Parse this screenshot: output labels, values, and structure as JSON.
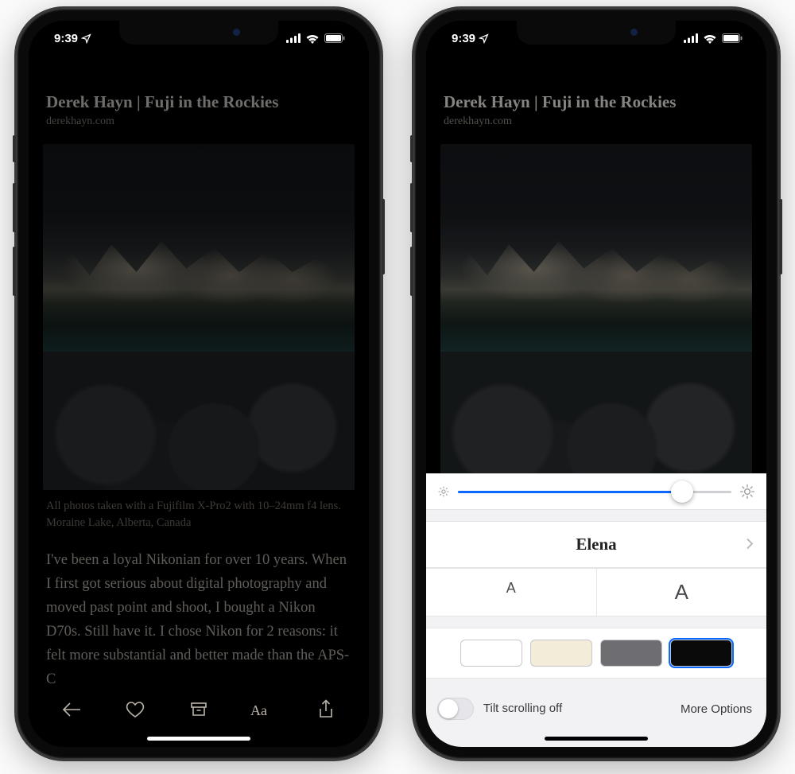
{
  "status": {
    "time": "9:39",
    "location_arrow": true
  },
  "article": {
    "title": "Derek Hayn | Fuji in the Rockies",
    "domain": "derekhayn.com",
    "caption": "All photos taken with a Fujifilm X-Pro2 with 10–24mm f4 lens. Moraine Lake, Alberta, Canada",
    "body": "I've been a loyal Nikonian for over 10 years. When I first got serious about digital photography and moved past point and shoot, I bought a Nikon D70s. Still have it. I chose Nikon for 2 reasons: it felt more substantial and better made than the APS-C"
  },
  "settings": {
    "brightness_pct": 82,
    "font_name": "Elena",
    "size_small": "A",
    "size_large": "A",
    "themes": [
      "white",
      "sepia",
      "gray",
      "black"
    ],
    "selected_theme": "black",
    "tilt_label": "Tilt scrolling off",
    "more_label": "More Options"
  }
}
